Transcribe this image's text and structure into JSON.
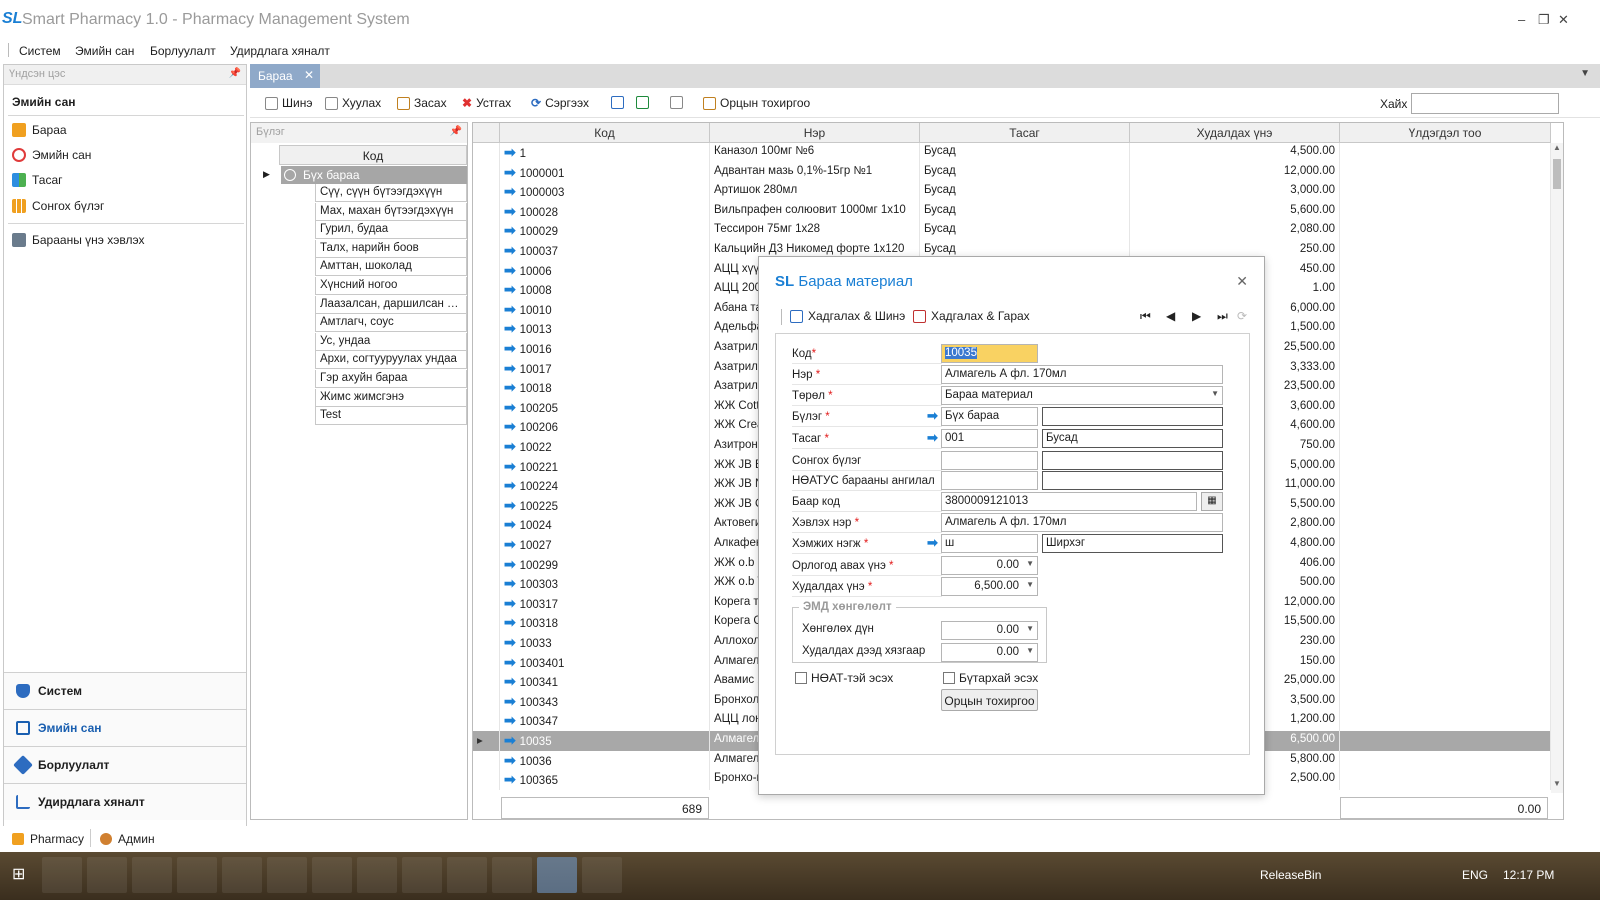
{
  "window": {
    "logo": "SL",
    "title": "Smart Pharmacy 1.0 - Pharmacy Management System",
    "min": "–",
    "restore": "❐",
    "close": "✕"
  },
  "menu": [
    "Систем",
    "Эмийн сан",
    "Борлуулалт",
    "Удирдлага хяналт"
  ],
  "nav": {
    "header": "Үндсэн цэс",
    "group": "Эмийн сан",
    "items": [
      "Бараа",
      "Эмийн сан",
      "Тасаг",
      "Сонгох бүлэг",
      "Барааны үнэ хэвлэх"
    ],
    "bottom": [
      "Систем",
      "Эмийн сан",
      "Борлуулалт",
      "Удирдлага хяналт"
    ]
  },
  "tab": {
    "label": "Бараа",
    "close": "✕"
  },
  "toolbar": {
    "new": "Шинэ",
    "copy": "Хуулах",
    "edit": "Засах",
    "delete": "Устгах",
    "refresh": "Сэргээх",
    "options": "Орцын тохиргоо",
    "search_label": "Хайх",
    "search_value": ""
  },
  "groups": {
    "header": "Бүлэг",
    "col": "Код",
    "root": "Бүх бараа",
    "items": [
      "Сүү, сүүн бүтээгдэхүүн",
      "Мах, махан бүтээгдэхүүн",
      "Гурил, будаа",
      "Талх, нарийн боов",
      "Амттан, шоколад",
      "Хүнсний ногоо",
      "Лаазалсан, даршилсан бү...",
      "Амтлагч, соус",
      "Ус, ундаа",
      "Архи, согтууруулах ундаа",
      "Гэр ахуйн бараа",
      "Жимс жимсгэнэ",
      "Test"
    ]
  },
  "grid": {
    "headers": [
      "Код",
      "Нэр",
      "Тасаг",
      "Худалдах үнэ",
      "Үлдэгдэл тоо"
    ],
    "rows": [
      [
        "1",
        "Каназол 100мг №6",
        "Бусад",
        "4,500.00"
      ],
      [
        "1000001",
        "Адвантан мазь 0,1%-15гр №1",
        "Бусад",
        "12,000.00"
      ],
      [
        "1000003",
        "Артишок 280мл",
        "Бусад",
        "3,000.00"
      ],
      [
        "100028",
        "Вильпрафен солюовит 1000мг 1х10",
        "Бусад",
        "5,600.00"
      ],
      [
        "100029",
        "Тессирон 75мг 1х28",
        "Бусад",
        "2,080.00"
      ],
      [
        "100037",
        "Кальцийн Д3 Никомед форте 1х120",
        "Бусад",
        "250.00"
      ],
      [
        "10006",
        "АЦЦ хүүх",
        "",
        "450.00"
      ],
      [
        "10008",
        "АЦЦ 200м",
        "",
        "1.00"
      ],
      [
        "10010",
        "Абана та",
        "",
        "6,000.00"
      ],
      [
        "10013",
        "Адельфа",
        "",
        "1,500.00"
      ],
      [
        "10016",
        "Азатрил",
        "",
        "25,500.00"
      ],
      [
        "10017",
        "Азатрил",
        "",
        "3,333.00"
      ],
      [
        "10018",
        "Азатрил",
        "",
        "23,500.00"
      ],
      [
        "100205",
        "ЖЖ Cotto",
        "",
        "3,600.00"
      ],
      [
        "100206",
        "ЖЖ Crea",
        "",
        "4,600.00"
      ],
      [
        "10022",
        "Азитрон",
        "",
        "750.00"
      ],
      [
        "100221",
        "ЖЖ JB Be",
        "",
        "5,000.00"
      ],
      [
        "100224",
        "ЖЖ JB No",
        "",
        "11,000.00"
      ],
      [
        "100225",
        "ЖЖ JB O",
        "",
        "5,500.00"
      ],
      [
        "10024",
        "Актовеги",
        "",
        "2,800.00"
      ],
      [
        "10027",
        "Алкафен",
        "",
        "4,800.00"
      ],
      [
        "100299",
        "ЖЖ o.b S",
        "",
        "406.00"
      ],
      [
        "100303",
        "ЖЖ o.b T",
        "",
        "500.00"
      ],
      [
        "100317",
        "Корега т",
        "",
        "12,000.00"
      ],
      [
        "100318",
        "Корега С",
        "",
        "15,500.00"
      ],
      [
        "10033",
        "Аллохол",
        "",
        "230.00"
      ],
      [
        "1003401",
        "Алмагель",
        "",
        "150.00"
      ],
      [
        "100341",
        "Авамис 2",
        "",
        "25,000.00"
      ],
      [
        "100343",
        "Бронхолі",
        "",
        "3,500.00"
      ],
      [
        "100347",
        "АЦЦ лонг",
        "",
        "1,200.00"
      ],
      [
        "10035",
        "Алмагель",
        "",
        "6,500.00"
      ],
      [
        "10036",
        "Алмагель",
        "",
        "5,800.00"
      ],
      [
        "100365",
        "Бронхо-м",
        "",
        "2,500.00"
      ]
    ],
    "selected_index": 30,
    "footer_count": "689",
    "footer_sum": "0.00"
  },
  "dialog": {
    "logo": "SL",
    "title": "Бараа материал",
    "close": "✕",
    "save_new": "Хадгалах & Шинэ",
    "save_exit": "Хадгалах & Гарах",
    "labels": {
      "code": "Код",
      "name": "Нэр",
      "type": "Төрөл",
      "group": "Бүлэг",
      "dept": "Тасаг",
      "choose_group": "Сонгох бүлэг",
      "vat_cat": "НӨАТУС барааны ангилал",
      "barcode": "Баар код",
      "print_name": "Хэвлэх нэр",
      "unit": "Хэмжих нэгж",
      "cost_price": "Орлогод авах үнэ",
      "sell_price": "Худалдах үнэ",
      "discount_legend": "ЭМД хөнгөлөлт",
      "discount_amount": "Хөнгөлөх дүн",
      "sell_limit": "Худалдах дээд хязгаар",
      "vat_check": "НӨАТ-тэй эсэх",
      "made_check": "Бүтархай эсэх",
      "options_btn": "Орцын тохиргоо"
    },
    "values": {
      "code": "10035",
      "name": "Алмагель А фл. 170мл",
      "type": "Бараа материал",
      "group": "Бүх бараа",
      "group2": "",
      "dept": "001",
      "dept2": "Бусад",
      "choose_group": "",
      "choose_group2": "",
      "vat_cat": "",
      "vat_cat2": "",
      "barcode": "3800009121013",
      "print_name": "Алмагель А фл. 170мл",
      "unit": "ш",
      "unit2": "Ширхэг",
      "cost_price": "0.00",
      "sell_price": "6,500.00",
      "discount_amount": "0.00",
      "sell_limit": "0.00"
    }
  },
  "status": {
    "app": "Pharmacy",
    "user": "Админ"
  },
  "taskbar": {
    "tray_label": "ReleaseBin",
    "lang": "ENG",
    "time": "12:17 PM"
  }
}
